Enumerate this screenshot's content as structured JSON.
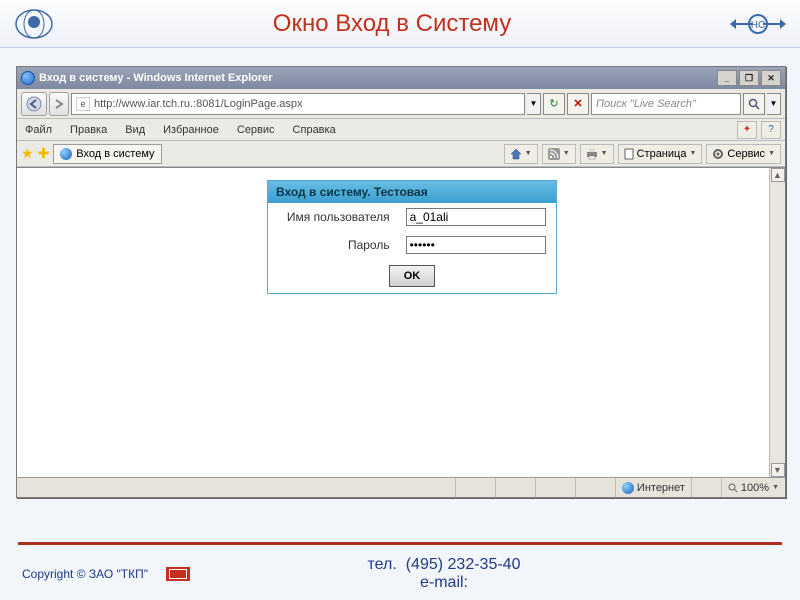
{
  "banner": {
    "title": "Окно Вход в Систему"
  },
  "ie": {
    "title": "Вход в систему - Windows Internet Explorer",
    "url": "http://www.iar.tch.ru.:8081/LoginPage.aspx",
    "search_placeholder": "Поиск \"Live Search\"",
    "menus": [
      "Файл",
      "Правка",
      "Вид",
      "Избранное",
      "Сервис",
      "Справка"
    ],
    "tab_label": "Вход в систему",
    "toolbar": {
      "page": "Страница",
      "service": "Сервис"
    },
    "status": {
      "zone": "Интернет",
      "zoom": "100%"
    }
  },
  "login": {
    "header": "Вход в систему. Тестовая",
    "user_label": "Имя пользователя",
    "pass_label": "Пароль",
    "user_value": "a_01ali",
    "pass_value": "••••••",
    "ok": "OK"
  },
  "footer": {
    "copyright": "Copyright © ЗАО \"ТКП\"",
    "tel_label": "тел.",
    "tel": "(495) 232-35-40",
    "email_label": "e-mail:"
  }
}
